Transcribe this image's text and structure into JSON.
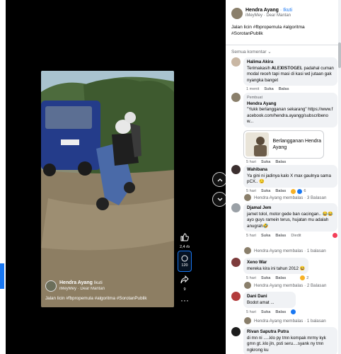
{
  "video": {
    "author": "Hendra Ayang",
    "follow": "Ikuti",
    "music": "iMeyMey · Dear Mantan",
    "caption": "Jalan licin #fbpropemula #algoritma #SorotanPublik",
    "likes": "2,4 rb",
    "comments": "120",
    "shares": "9"
  },
  "panel": {
    "author": "Hendra Ayang",
    "follow": "· Ikuti",
    "music": "iMeyMey · Dear Mantan",
    "post_line1": "Jalan licin #fbpropemula #algoritma",
    "post_line2": "#SorotanPublik",
    "sort_label": "Semua komentar ⌄"
  },
  "comments": [
    {
      "name": "Halima Akira",
      "text": "Terimakasih 𝐀𝐋𝐄𝐗𝐈𝐒𝐓𝐎𝐆𝐄𝐋 padahal cuman modal receh tapi masi di kasi wd jutaan gak nyangka banget",
      "time": "1 menit",
      "like": "Suka",
      "reply": "Balas"
    },
    {
      "sponsor": "Pembuat",
      "name": "Hendra Ayang",
      "text": "\"Yukk berlangganan sekarang\" https://www.facebook.com/hendra.ayangg/subscribenow...",
      "card": "Berlangganan Hendra Ayang",
      "time": "5 hari",
      "like": "Suka",
      "reply": "Balas"
    },
    {
      "name": "Wahibana",
      "text": "Ya gini ni jadinya kalo X max gaulnya sama pCX.. 😏",
      "time": "5 hari",
      "like": "Suka",
      "reply": "Balas",
      "reacts": "6"
    },
    {
      "name": "Djamal Jem",
      "text": "jamet tolol, motor gede ban cacingan.. 😂😂 ayo guys ramein terus, hujatan mu adalah anugrah🤣",
      "time": "5 hari",
      "like": "Suka",
      "reply": "Balas",
      "edited": "Diedit"
    },
    {
      "name": "Xeno War",
      "text": "mereka kira ini tahun 2012 😆",
      "time": "5 hari",
      "like": "Suka",
      "reply": "Balas",
      "reacts": "2"
    },
    {
      "name": "Dani Dani",
      "text": "Bodot amat ...",
      "time": "5 hari",
      "like": "Suka",
      "reply": "Balas"
    },
    {
      "name": "Rivan Saputra Putra",
      "text": "di mn ni .....klo py tmn kompak mrmy kyk gmn gt..klo jln, psti seru....syank ny tmn ngkrong ku"
    }
  ],
  "replies": [
    {
      "text": "Hendra Ayang membalas · 3 Balasan"
    },
    {
      "text": "Hendra Ayang membalas · 1 balasan"
    },
    {
      "text": "Hendra Ayang membalas · 2 Balasan"
    },
    {
      "text": "Hendra Ayang membalas · 1 balasan"
    }
  ],
  "colors": {
    "accent": "#1877f2",
    "like": "#1877f2",
    "haha": "#f7b125",
    "love": "#f33e58"
  }
}
